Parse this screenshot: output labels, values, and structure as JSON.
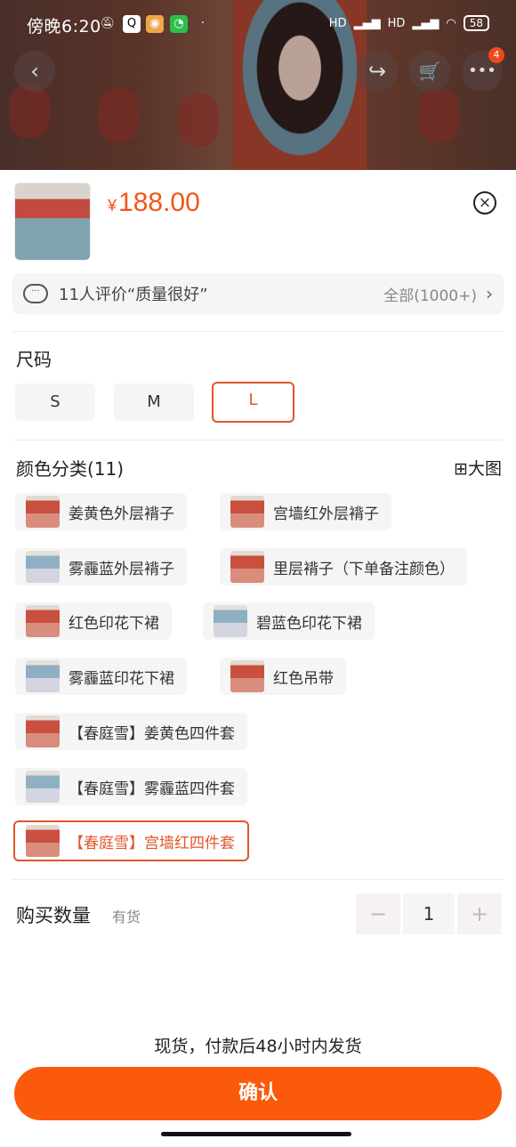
{
  "status_bar": {
    "time": "傍晚6:20",
    "battery": "58",
    "signal_label": "HD"
  },
  "header": {
    "back_icon": "‹",
    "share_icon": "↪",
    "cart_icon": "🛒",
    "cart_badge": "4"
  },
  "product": {
    "currency": "¥",
    "price": "188.00",
    "close_icon": "×"
  },
  "review": {
    "chat_icon": "···",
    "text": "11人评价“质量很好”",
    "all": "全部(1000+)",
    "chevron": "›"
  },
  "size": {
    "title": "尺码",
    "options": [
      "S",
      "M",
      "L"
    ],
    "selected": "L"
  },
  "color": {
    "title": "颜色分类(11)",
    "big_image": "大图",
    "options": [
      "姜黄色外层褙子",
      "宫墙红外层褙子",
      "雾霾蓝外层褙子",
      "里层褙子（下单备注颜色）",
      "红色印花下裙",
      "碧蓝色印花下裙",
      "雾霾蓝印花下裙",
      "红色吊带",
      "【春庭雪】姜黄色四件套",
      "【春庭雪】雾霾蓝四件套",
      "【春庭雪】宫墙红四件套"
    ],
    "selected": "【春庭雪】宫墙红四件套"
  },
  "quantity": {
    "label": "购买数量",
    "stock": "有货",
    "minus": "−",
    "value": "1",
    "plus": "+"
  },
  "footer": {
    "ship_note": "现货，付款后48小时内发货",
    "confirm": "确认"
  },
  "colors": {
    "accent": "#fb5a0c",
    "price": "#f2551b",
    "selected_border": "#e0562a"
  }
}
